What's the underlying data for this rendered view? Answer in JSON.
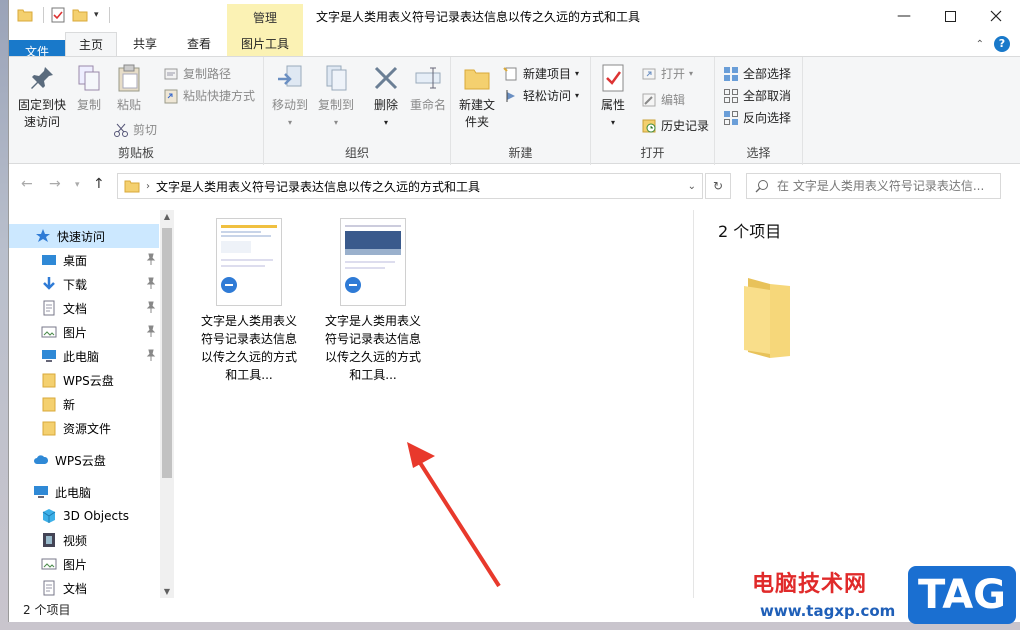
{
  "window": {
    "title": "文字是人类用表义符号记录表达信息以传之久远的方式和工具",
    "context_tab_group": "管理"
  },
  "tabs": [
    "文件",
    "主页",
    "共享",
    "查看",
    "图片工具"
  ],
  "ribbon": {
    "clipboard": {
      "group": "剪贴板",
      "pin_quick": "固定到快速访问",
      "copy": "复制",
      "paste": "粘贴",
      "copy_path": "复制路径",
      "paste_shortcut": "粘贴快捷方式",
      "cut": "剪切"
    },
    "organize": {
      "group": "组织",
      "move_to": "移动到",
      "copy_to": "复制到",
      "delete": "删除",
      "rename": "重命名"
    },
    "new": {
      "group": "新建",
      "new_folder": "新建文件夹",
      "new_item": "新建项目",
      "easy_access": "轻松访问"
    },
    "open": {
      "group": "打开",
      "properties": "属性",
      "open": "打开",
      "edit": "编辑",
      "history": "历史记录"
    },
    "select": {
      "group": "选择",
      "select_all": "全部选择",
      "select_none": "全部取消",
      "invert": "反向选择"
    }
  },
  "address": {
    "path": "文字是人类用表义符号记录表达信息以传之久远的方式和工具",
    "search_placeholder": "在 文字是人类用表义符号记录表达信..."
  },
  "nav": {
    "quick_access": "快速访问",
    "items": [
      "桌面",
      "下载",
      "文档",
      "图片",
      "此电脑",
      "WPS云盘",
      "新",
      "资源文件"
    ],
    "wps_cloud": "WPS云盘",
    "this_pc": "此电脑",
    "pc_items": [
      "3D Objects",
      "视频",
      "图片",
      "文档"
    ]
  },
  "files": [
    {
      "name": "文字是人类用表义符号记录表达信息以传之久远的方式和工具..."
    },
    {
      "name": "文字是人类用表义符号记录表达信息以传之久远的方式和工具..."
    }
  ],
  "preview": {
    "count": "2 个项目"
  },
  "status": {
    "count": "2 个项目"
  },
  "watermark": {
    "site_name": "电脑技术网",
    "url": "www.tagxp.com",
    "logo": "TAG"
  },
  "colors": {
    "file_tab": "#1979ca",
    "selected": "#cce8ff",
    "context": "#fbf2b4",
    "folder": "#f4d06f"
  }
}
